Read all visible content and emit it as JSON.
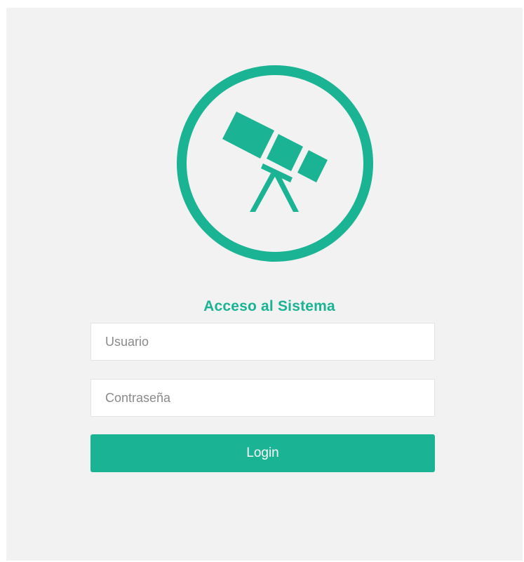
{
  "colors": {
    "accent": "#1ab394",
    "panel_background": "#f2f2f2",
    "field_background": "#ffffff"
  },
  "logo": {
    "icon": "telescope-icon"
  },
  "login": {
    "title": "Acceso al Sistema",
    "username_placeholder": "Usuario",
    "password_placeholder": "Contraseña",
    "submit_label": "Login"
  }
}
